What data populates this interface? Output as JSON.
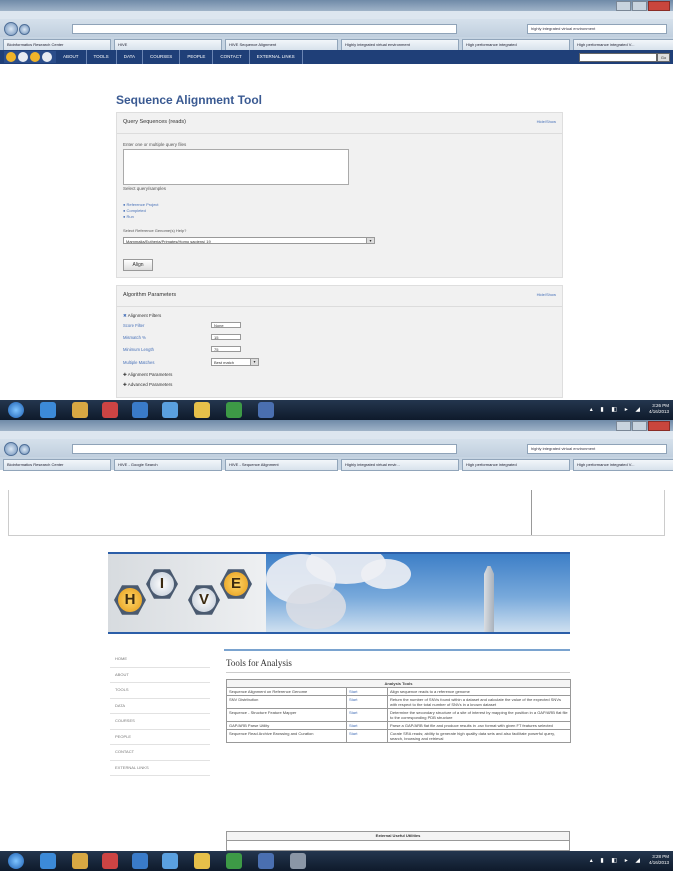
{
  "colors": {
    "nav_bg": "#1f3f78",
    "link": "#4670b8",
    "title": "#3a5a92",
    "panel_bg": "#f1f1f1"
  },
  "screen1": {
    "browser": {
      "search_text": "highly integrated virtual environment",
      "tabs": [
        "Bioinformatics Research Center",
        "HIVE",
        "HIVE Sequence Alignment",
        "Highly integrated virtual environment",
        "High performance integrated",
        "High performance integrated V..."
      ]
    },
    "site_nav": [
      "ABOUT",
      "TOOLS",
      "DATA",
      "COURSES",
      "PEOPLE",
      "CONTACT",
      "EXTERNAL LINKS"
    ],
    "site_search_button": "Go",
    "page_title": "Sequence Alignment Tool",
    "query_panel": {
      "header": "Query Sequences (reads)",
      "toggle": "Hide/Show",
      "textarea_label": "Enter one or multiple query files",
      "select_label": "Select query/samples",
      "links": [
        "Reference Project",
        "Completed",
        "Run"
      ],
      "reference_label": "Select Reference Genome(s) Help?",
      "reference_value": "Mammalia/Eutheria/Primates/Homo sapiens/ 19",
      "align_button": "Align"
    },
    "algorithm_panel": {
      "header": "Algorithm Parameters",
      "toggle": "Hide/Show",
      "filters_label": "Alignment Filters",
      "params": [
        {
          "label": "Score Filter",
          "value": "None"
        },
        {
          "label": "Mismatch %",
          "value": "15"
        },
        {
          "label": "Minimum Length",
          "value": "75"
        },
        {
          "label": "Multiple Matches",
          "value": "Best match"
        }
      ],
      "expanders": [
        "Alignment Parameters",
        "Advanced Parameters"
      ]
    },
    "clock": {
      "time": "3:26 PM",
      "date": "4/16/2013"
    }
  },
  "screen2": {
    "browser": {
      "search_text": "highly integrated virtual environment",
      "tabs": [
        "Bioinformatics Research Center",
        "HIVE - Google Search",
        "HIVE - Sequence Alignment",
        "Highly integrated virtual envir...",
        "High performance integrated",
        "High performance integrated V..."
      ]
    },
    "logo_letters": [
      "H",
      "I",
      "V",
      "E"
    ],
    "side_nav": [
      "HOME",
      "ABOUT",
      "TOOLS",
      "DATA",
      "COURSES",
      "PEOPLE",
      "CONTACT",
      "EXTERNAL LINKS"
    ],
    "tools_title": "Tools for Analysis",
    "analysis_header": "Analysis Tools",
    "tools": [
      {
        "name": "Sequence Alignment on Reference Genome",
        "action": "Start",
        "desc": "Align sequence reads to a reference genome"
      },
      {
        "name": "SNV Distribution",
        "action": "Start",
        "desc": "Return the number of SNVs found within a dataset and calculate the value of the expected SNVs with respect to the total number of SNVs in a known dataset"
      },
      {
        "name": "Sequence - Structure Feature Mapper",
        "action": "Start",
        "desc": "Determine the secondary structure of a site of interest by mapping the position in a GAP/ARB flat file to the corresponding PDB structure"
      },
      {
        "name": "GAP/ARB Parse Utility",
        "action": "Start",
        "desc": "Parse a GAP/ARB flat file and produce results in .csv format with given FT features selected"
      },
      {
        "name": "Sequence Read Archive Browsing and Curation",
        "action": "Start",
        "desc": "Curate SRA reads; ability to generate high quality data sets and also facilitate powerful query, search, browsing and retrieval"
      }
    ],
    "external_header": "External Useful Utilities",
    "clock": {
      "time": "3:28 PM",
      "date": "4/16/2013"
    }
  }
}
